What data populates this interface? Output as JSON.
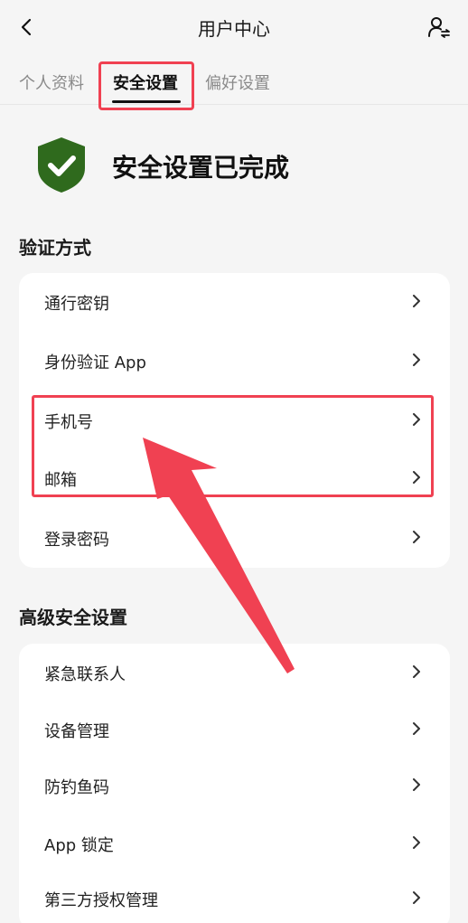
{
  "header": {
    "title": "用户中心",
    "back_icon": "chevron-left-icon",
    "user_icon": "user-switch-icon"
  },
  "tabs": [
    {
      "label": "个人资料",
      "active": false
    },
    {
      "label": "安全设置",
      "active": true
    },
    {
      "label": "偏好设置",
      "active": false
    }
  ],
  "status": {
    "text": "安全设置已完成",
    "icon": "shield-check-icon",
    "icon_color": "#2f6a1d"
  },
  "sections": [
    {
      "title": "验证方式",
      "items": [
        {
          "label": "通行密钥"
        },
        {
          "label": "身份验证 App"
        },
        {
          "label": "手机号"
        },
        {
          "label": "邮箱"
        },
        {
          "label": "登录密码"
        }
      ]
    },
    {
      "title": "高级安全设置",
      "items": [
        {
          "label": "紧急联系人"
        },
        {
          "label": "设备管理"
        },
        {
          "label": "防钓鱼码"
        },
        {
          "label": "App 锁定"
        },
        {
          "label": "第三方授权管理"
        }
      ]
    }
  ],
  "annotation": {
    "highlight_color": "#f04152"
  }
}
